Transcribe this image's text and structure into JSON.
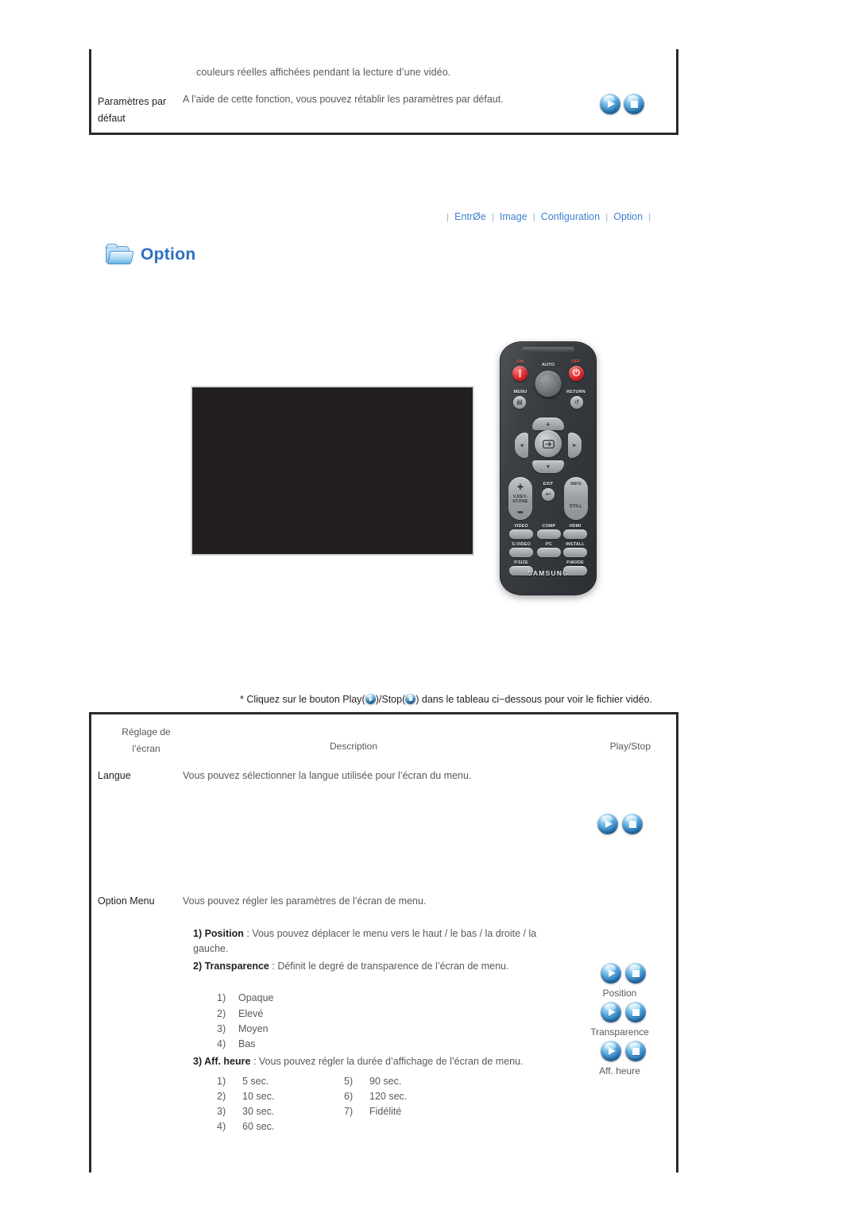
{
  "top_section": {
    "continued_line": "couleurs réelles affichées pendant la lecture d’une vidéo.",
    "row_label_line1": "Paramètres par",
    "row_label_line2": "défaut",
    "row_description": "A l’aide de cette fonction, vous pouvez rétablir les paramètres par défaut."
  },
  "tabs": [
    {
      "label": "EntrØe"
    },
    {
      "label": "Image"
    },
    {
      "label": "Configuration"
    },
    {
      "label": "Option"
    }
  ],
  "tab_separator": "|",
  "section": {
    "title": "Option",
    "icon": "folder-icon",
    "accent_color": "#2e6fc0"
  },
  "media": {
    "video_placeholder_color": "#231f20"
  },
  "remote": {
    "brand": "SAMSUNG",
    "labels": {
      "on": "ON",
      "off": "OFF",
      "auto": "AUTO",
      "menu": "MENU",
      "return": "RETURN",
      "exit": "EXIT",
      "info": "INFO",
      "still": "STILL",
      "keystone_line1": "V.KEY-",
      "keystone_line2": "STONE",
      "video": "VIDEO",
      "comp": "COMP",
      "hdmi": "HDMI",
      "svideo": "S-VIDEO",
      "pc": "PC",
      "install": "INSTALL",
      "psize": "P.SIZE",
      "pmode": "P.MODE",
      "plus": "+",
      "minus": "−",
      "arrow_up": "▲",
      "arrow_down": "▼",
      "arrow_left": "◄",
      "arrow_right": "►"
    }
  },
  "caption": {
    "prefix": "* Cliquez sur le bouton Play(",
    "middle": ")/Stop(",
    "suffix": ") dans le tableau ci−dessous pour voir le fichier vidéo."
  },
  "table": {
    "headers": {
      "col1_line1": "Réglage de",
      "col1_line2": "l’écran",
      "col2": "Description",
      "col3": "Play/Stop"
    },
    "rows": [
      {
        "label": "Langue",
        "description": "Vous pouvez sélectionner la langue utilisée pour l’écran du menu."
      },
      {
        "label": "Option Menu",
        "description": "Vous pouvez régler les paramètres de l’écran de menu."
      }
    ],
    "option_menu_items": [
      {
        "num": "1) Position",
        "sep": " : ",
        "text_line1": "Vous pouvez déplacer le menu vers le haut / le bas / la droite / la",
        "text_line2": "gauche."
      },
      {
        "num": "2) Transparence",
        "sep": " : ",
        "text_line1": "Définit le degré de transparence de l’écran de menu."
      },
      {
        "num": "3) Aff. heure",
        "sep": " : ",
        "text_line1": "Vous pouvez régler la durée d’affichage de l’écran de menu."
      }
    ],
    "transparence_values": [
      {
        "num": "1)",
        "label": "Opaque"
      },
      {
        "num": "2)",
        "label": "Elevé"
      },
      {
        "num": "3)",
        "label": "Moyen"
      },
      {
        "num": "4)",
        "label": "Bas"
      }
    ],
    "time_values_left": [
      {
        "num": "1)",
        "label": "5 sec."
      },
      {
        "num": "2)",
        "label": "10 sec."
      },
      {
        "num": "3)",
        "label": "30 sec."
      },
      {
        "num": "4)",
        "label": "60 sec."
      }
    ],
    "time_values_right": [
      {
        "num": "5)",
        "label": "90 sec."
      },
      {
        "num": "6)",
        "label": "120 sec."
      },
      {
        "num": "7)",
        "label": "Fidélité"
      }
    ],
    "play_stop_groups": [
      {
        "label": "Position"
      },
      {
        "label": "Transparence"
      },
      {
        "label": "Aff. heure"
      }
    ]
  }
}
